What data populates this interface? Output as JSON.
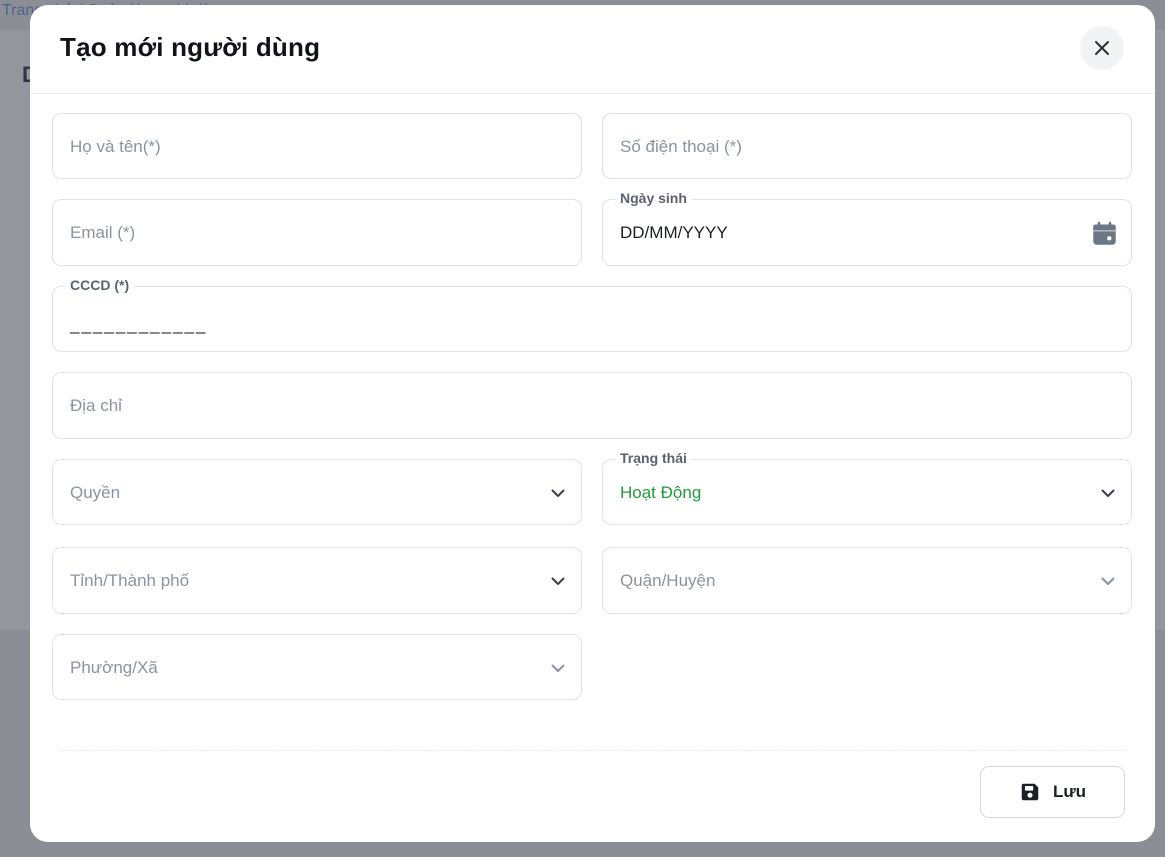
{
  "background": {
    "breadcrumb": "Trang chủ / Quản lý người dùng",
    "heading_initial": "D"
  },
  "modal": {
    "title": "Tạo mới người dùng",
    "close_icon": "close-icon"
  },
  "form": {
    "full_name": {
      "placeholder": "Họ và tên(*)"
    },
    "phone": {
      "placeholder": "Số điện thoại (*)"
    },
    "email": {
      "placeholder": "Email (*)"
    },
    "birthday": {
      "label": "Ngày sinh",
      "value": "DD/MM/YYYY",
      "icon": "calendar-icon"
    },
    "cccd": {
      "label": "CCCD (*)",
      "value": "____________"
    },
    "address": {
      "placeholder": "Địa chỉ"
    },
    "role": {
      "placeholder": "Quyền"
    },
    "status": {
      "label": "Trạng thái",
      "value": "Hoạt Động",
      "value_color": "#1f9d3a"
    },
    "province": {
      "placeholder": "Tỉnh/Thành phố"
    },
    "district": {
      "placeholder": "Quận/Huyện"
    },
    "ward": {
      "placeholder": "Phường/Xã"
    }
  },
  "footer": {
    "save_label": "Lưu",
    "save_icon": "floppy-disk-icon"
  }
}
